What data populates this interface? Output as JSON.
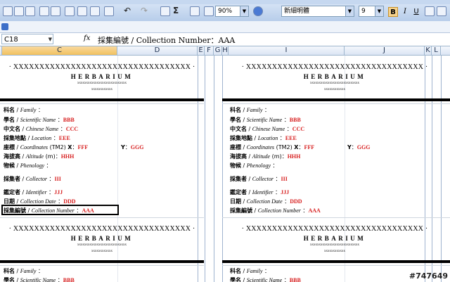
{
  "toolbar": {
    "zoom": "90%",
    "font_name": "新細明體",
    "font_size": "9",
    "bold": "B",
    "italic": "I",
    "underline": "U",
    "sum": "Σ",
    "undo_arrow": "↶",
    "redo_arrow": "↷"
  },
  "formula_bar": {
    "name_box": "C18",
    "fx": "fx",
    "formula": "採集編號 / Collection Number：AAA"
  },
  "columns": [
    "C",
    "D",
    "E",
    "F",
    "G",
    "H",
    "I",
    "J",
    "K",
    "L"
  ],
  "card": {
    "header_x": "· XXXXXXXXXXXXXXXXXXXXXXXXXXXXXXXXXX ·",
    "herbarium": "HERBARIUM",
    "tiny1": "xxxxxxxxxxxxxxxxxxxxxxxxxxxx",
    "tiny2": "xxxxxxxxxxxx",
    "fields": {
      "family": {
        "zh": "科名",
        "en": "Family",
        "value": ""
      },
      "scientific": {
        "zh": "學名",
        "en": "Scientific Name",
        "value": "BBB"
      },
      "chinese": {
        "zh": "中文名",
        "en": "Chinese Name",
        "value": "CCC"
      },
      "location": {
        "zh": "採集地點",
        "en": "Location",
        "value": "EEE"
      },
      "coord": {
        "zh": "座標",
        "en": "Coordinates",
        "suffix": "(TM2)",
        "x_label": "X",
        "x_value": "FFF",
        "y_label": "Y",
        "y_value": "GGG"
      },
      "altitude": {
        "zh": "海拔高",
        "en": "Altitude",
        "suffix": "(m)",
        "value": "HHH"
      },
      "phenology": {
        "zh": "物候",
        "en": "Phenology",
        "value": ""
      },
      "collector": {
        "zh": "採集者",
        "en": "Collector",
        "value": "III"
      },
      "identifier": {
        "zh": "鑑定者",
        "en": "Identifier",
        "value": "JJJ"
      },
      "date": {
        "zh": "日期",
        "en": "Collection Date",
        "value": "DDD"
      },
      "number": {
        "zh": "採集編號",
        "en": "Collection Number",
        "value": "AAA"
      }
    }
  },
  "watermark": "#747649"
}
